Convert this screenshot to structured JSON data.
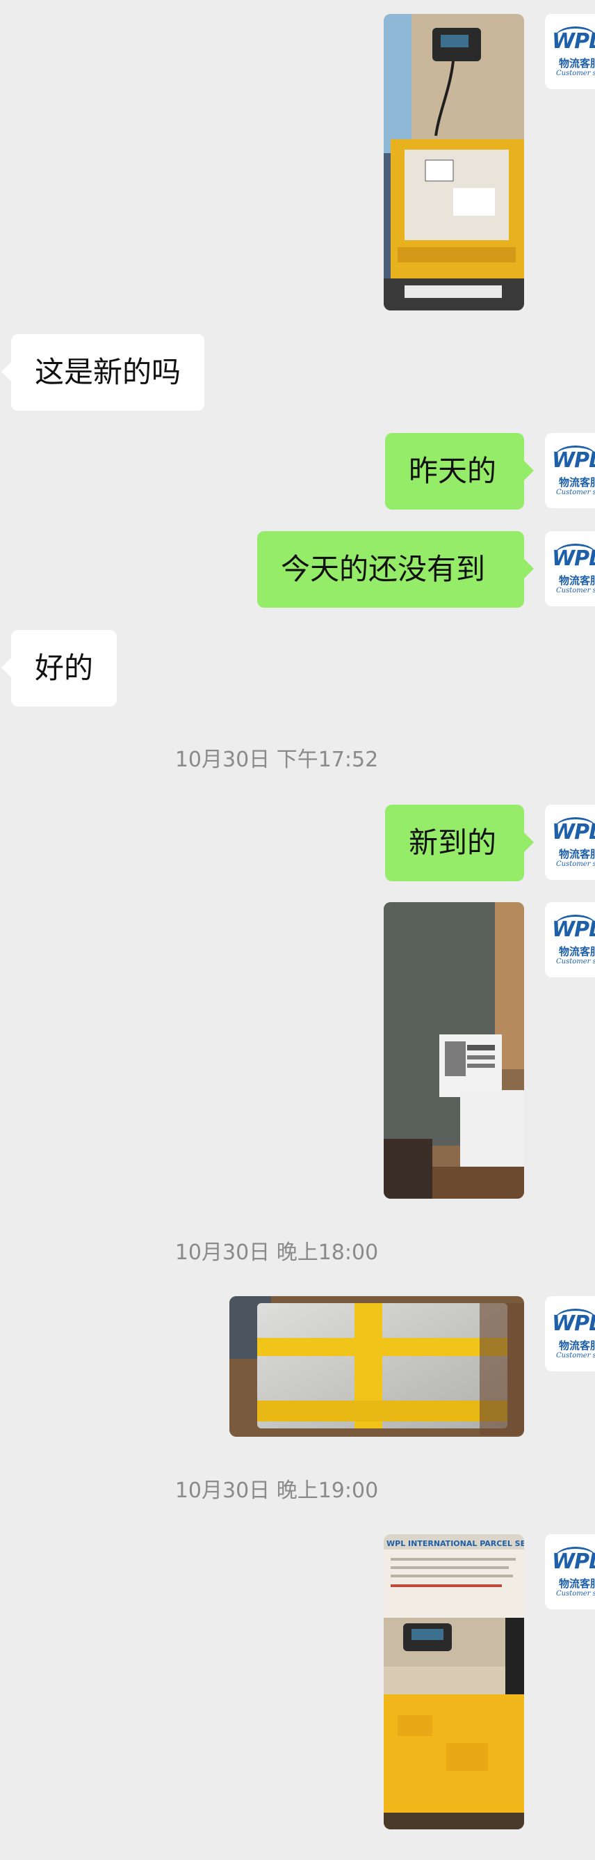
{
  "avatar": {
    "logo": "WPL",
    "sub": "物流客服",
    "sub2": "Customer service"
  },
  "messages": [
    {
      "type": "image",
      "side": "right",
      "alt": "box on scale with yellow tape"
    },
    {
      "type": "text",
      "side": "left",
      "text": "这是新的吗"
    },
    {
      "type": "text",
      "side": "right",
      "text": "昨天的"
    },
    {
      "type": "text",
      "side": "right",
      "text": "今天的还没有到"
    },
    {
      "type": "text",
      "side": "left",
      "text": "好的"
    },
    {
      "type": "timestamp",
      "text": "10月30日 下午17:52"
    },
    {
      "type": "text",
      "side": "right",
      "text": "新到的"
    },
    {
      "type": "image",
      "side": "right",
      "alt": "grey mailer parcel with label"
    },
    {
      "type": "timestamp",
      "text": "10月30日 晚上18:00"
    },
    {
      "type": "image",
      "side": "right",
      "alt": "parcel wrapped in clear and yellow tape"
    },
    {
      "type": "timestamp",
      "text": "10月30日 晚上19:00"
    },
    {
      "type": "image",
      "side": "right",
      "alt": "yellow box on scale under WPL sign"
    }
  ],
  "photo4_sign": "WPL INTERNATIONAL PARCEL SERVICE"
}
